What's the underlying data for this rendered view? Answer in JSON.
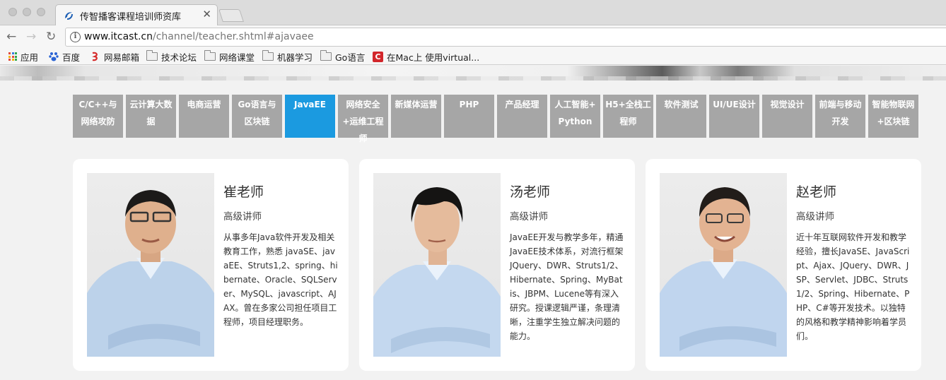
{
  "browser": {
    "tab_title": "传智播客课程培训师资库",
    "url_host": "www.itcast.cn",
    "url_path": "/channel/teacher.shtml#ajavaee",
    "bookmarks": [
      "应用",
      "百度",
      "网易邮箱",
      "技术论坛",
      "网络课堂",
      "机器学习",
      "Go语言",
      "在Mac上 使用virtual..."
    ]
  },
  "categories": [
    {
      "label": "C/C++与网络攻防",
      "active": false
    },
    {
      "label": "云计算大数据",
      "active": false
    },
    {
      "label": "电商运营",
      "active": false
    },
    {
      "label": "Go语言与区块链",
      "active": false
    },
    {
      "label": "JavaEE",
      "active": true
    },
    {
      "label": "网络安全+运维工程师",
      "active": false
    },
    {
      "label": "新媒体运营",
      "active": false
    },
    {
      "label": "PHP",
      "active": false
    },
    {
      "label": "产品经理",
      "active": false
    },
    {
      "label": "人工智能+Python",
      "active": false
    },
    {
      "label": "H5+全栈工程师",
      "active": false
    },
    {
      "label": "软件测试",
      "active": false
    },
    {
      "label": "UI/UE设计",
      "active": false
    },
    {
      "label": "视觉设计",
      "active": false
    },
    {
      "label": "前端与移动开发",
      "active": false
    },
    {
      "label": "智能物联网+区块链",
      "active": false
    }
  ],
  "teachers": [
    {
      "name": "崔老师",
      "title": "高级讲师",
      "desc": "从事多年Java软件开发及相关教育工作，熟悉 javaSE、javaEE、Struts1,2、spring、hibernate、Oracle、SQLServer、MySQL、javascript、AJAX。曾在多家公司担任项目工程师，项目经理职务。"
    },
    {
      "name": "汤老师",
      "title": "高级讲师",
      "desc": "JavaEE开发与教学多年，精通JavaEE技术体系，对流行框架JQuery、DWR、Struts1/2、Hibernate、Spring、MyBatis、JBPM、Lucene等有深入研究。授课逻辑严谨，条理清晰，注重学生独立解决问题的能力。"
    },
    {
      "name": "赵老师",
      "title": "高级讲师",
      "desc": "近十年互联网软件开发和教学经验，擅长JavaSE、JavaScript、Ajax、JQuery、DWR、JSP、Servlet、JDBC、Struts1/2、Spring、Hibernate、PHP、C#等开发技术。以独特的风格和教学精神影响着学员们。"
    }
  ],
  "colors": {
    "active_tab": "#1b9ae0",
    "inactive_tab": "#a6a6a6",
    "page_bg": "#f2f2f2"
  }
}
